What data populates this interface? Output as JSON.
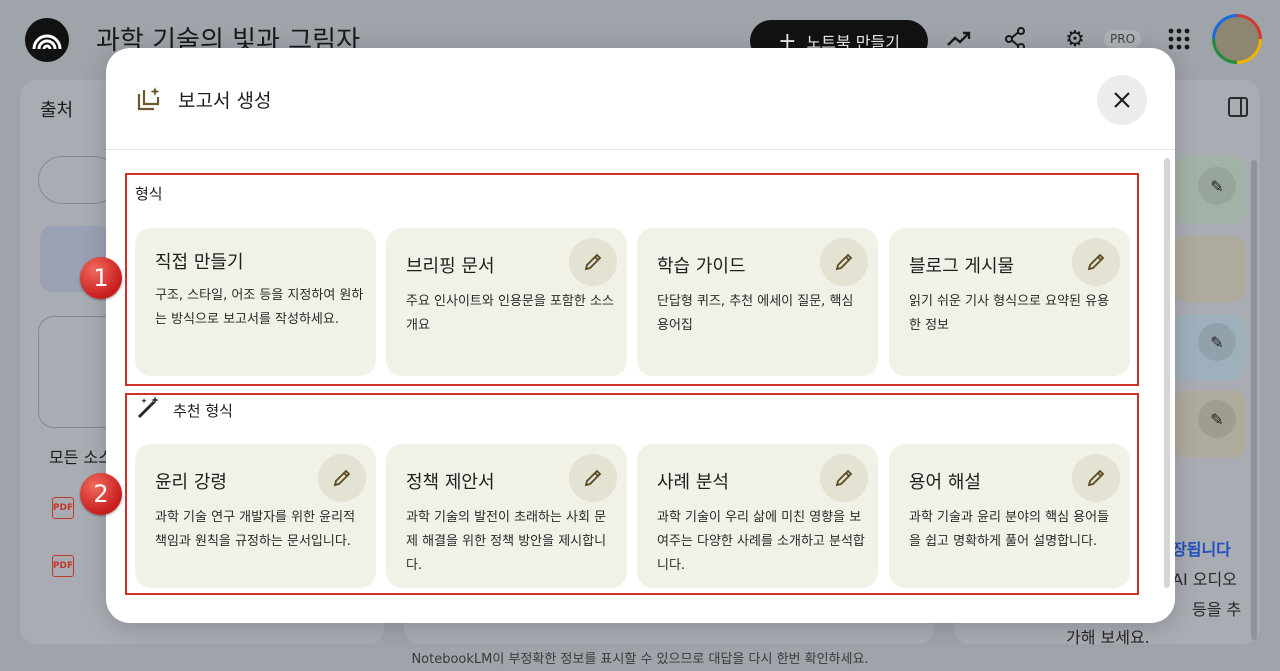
{
  "app": {
    "title": "과학 기술의 빛과 그림자",
    "new_notebook_label": "노트북 만들기",
    "pro_badge": "PRO",
    "sources_title": "출처",
    "all_sources_label": "모든 소스",
    "pdf_label": "PDF",
    "footer_note": "NotebookLM이 부정확한 정보를 표시할 수 있으므로 대답을 다시 한번 확인하세요.",
    "right_panel_link": "장됩니다",
    "right_panel_text_1": "AI 오디오",
    "right_panel_text_2": "등을 추",
    "right_panel_text_3": "가해 보세요."
  },
  "modal": {
    "title": "보고서 생성",
    "format_section": {
      "label": "형식",
      "cards": [
        {
          "title": "직접 만들기",
          "desc": "구조, 스타일, 어조 등을 지정하여 원하는 방식으로 보고서를 작성하세요.",
          "editable": false
        },
        {
          "title": "브리핑 문서",
          "desc": "주요 인사이트와 인용문을 포함한 소스 개요",
          "editable": true
        },
        {
          "title": "학습 가이드",
          "desc": "단답형 퀴즈, 추천 에세이 질문, 핵심 용어집",
          "editable": true
        },
        {
          "title": "블로그 게시물",
          "desc": "읽기 쉬운 기사 형식으로 요약된 유용한 정보",
          "editable": true
        }
      ]
    },
    "suggested_section": {
      "label": "추천 형식",
      "cards": [
        {
          "title": "윤리 강령",
          "desc": "과학 기술 연구 개발자를 위한 윤리적 책임과 원칙을 규정하는 문서입니다.",
          "editable": true
        },
        {
          "title": "정책 제안서",
          "desc": "과학 기술의 발전이 초래하는 사회 문제 해결을 위한 정책 방안을 제시합니다.",
          "editable": true
        },
        {
          "title": "사례 분석",
          "desc": "과학 기술이 우리 삶에 미친 영향을 보여주는 다양한 사례를 소개하고 분석합니다.",
          "editable": true
        },
        {
          "title": "용어 해설",
          "desc": "과학 기술과 윤리 분야의 핵심 용어들을 쉽고 명확하게 풀어 설명합니다.",
          "editable": true
        }
      ]
    },
    "annotations": [
      "1",
      "2"
    ]
  },
  "colors": {
    "card_bg": "#f2f1e8",
    "highlight_border": "#d0312d",
    "annotation_badge": "#c81d1d"
  },
  "icons": [
    "report-sparkle-icon",
    "close-icon",
    "pencil-icon",
    "magic-wand-icon",
    "trending-icon",
    "share-icon",
    "gear-icon",
    "apps-grid-icon",
    "plus-icon",
    "pdf-icon"
  ]
}
